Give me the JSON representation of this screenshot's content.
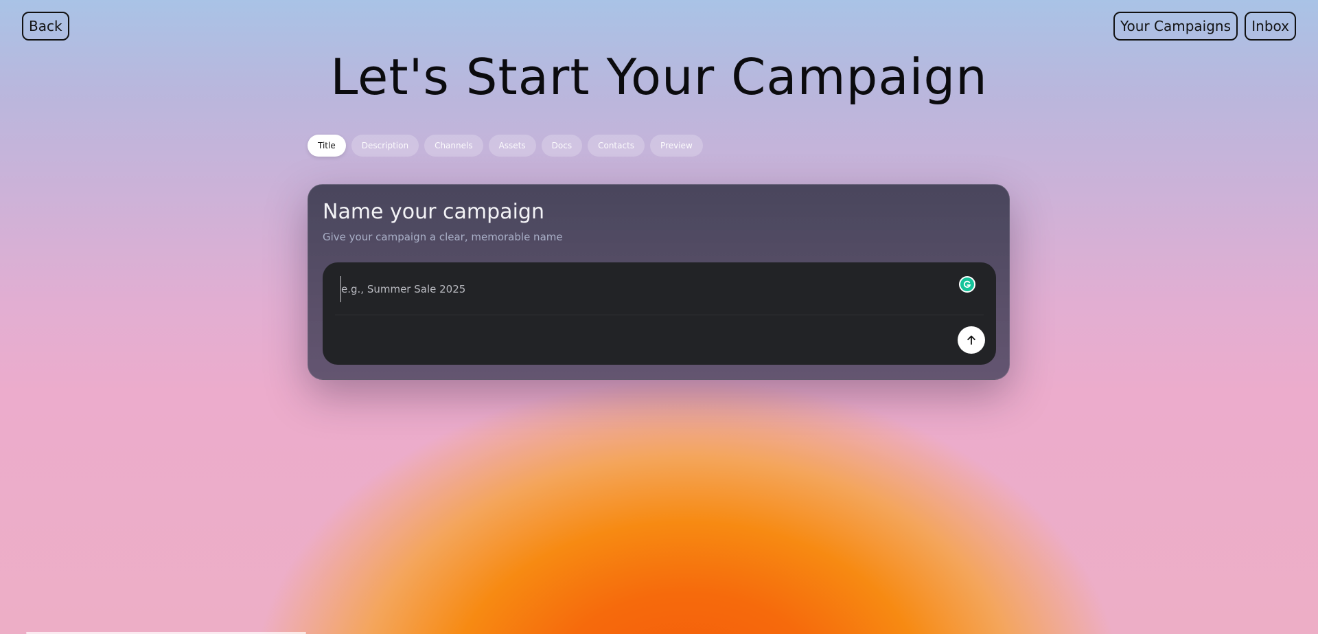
{
  "nav": {
    "back_label": "Back",
    "campaigns_label": "Your Campaigns",
    "inbox_label": "Inbox"
  },
  "page_title": "Let's Start Your Campaign",
  "steps": [
    {
      "label": "Title",
      "active": true
    },
    {
      "label": "Description",
      "active": false
    },
    {
      "label": "Channels",
      "active": false
    },
    {
      "label": "Assets",
      "active": false
    },
    {
      "label": "Docs",
      "active": false
    },
    {
      "label": "Contacts",
      "active": false
    },
    {
      "label": "Preview",
      "active": false
    }
  ],
  "card": {
    "title": "Name your campaign",
    "subtitle": "Give your campaign a clear, memorable name",
    "input": {
      "value": "",
      "placeholder": "e.g., Summer Sale 2025"
    }
  },
  "icons": {
    "grammar": "grammar-check-icon",
    "submit": "arrow-up-icon"
  },
  "colors": {
    "accent_green": "#15c39a",
    "card_bg": "#222326"
  }
}
